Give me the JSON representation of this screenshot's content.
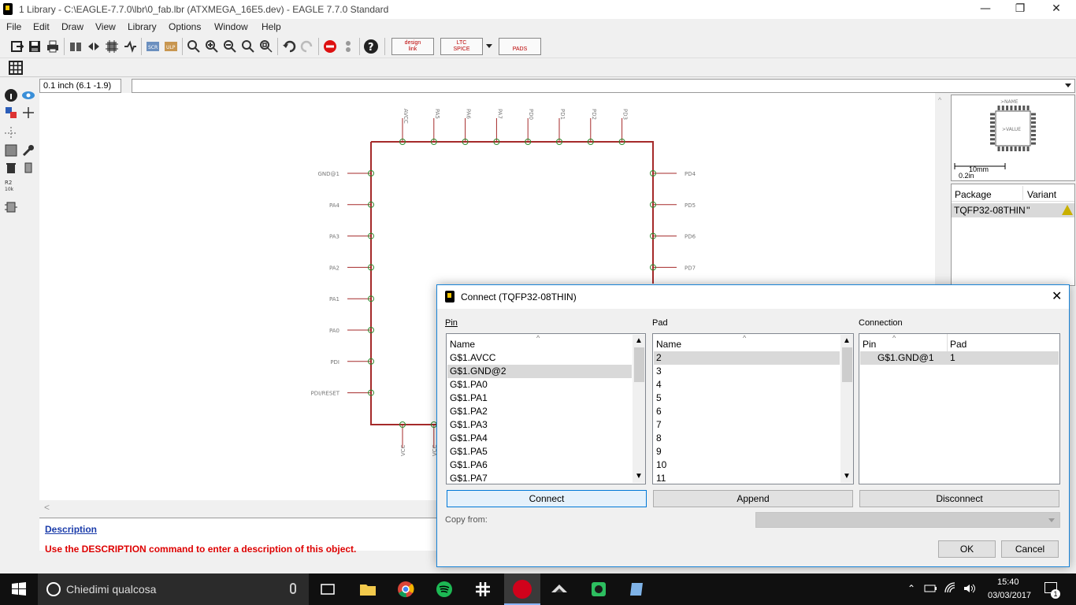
{
  "window": {
    "title": "1 Library - C:\\EAGLE-7.7.0\\lbr\\0_fab.lbr (ATXMEGA_16E5.dev) - EAGLE 7.7.0 Standard",
    "minimize": "—",
    "maximize": "❐",
    "close": "✕"
  },
  "menu": [
    "File",
    "Edit",
    "Draw",
    "View",
    "Library",
    "Options",
    "Window",
    "Help"
  ],
  "toolbar": {
    "icons": [
      "open-icon",
      "save-icon",
      "print-icon",
      "cam-icon",
      "fwd-back-icon",
      "board-icon",
      "schematic-icon",
      "script-icon",
      "run-icon",
      "zoom-fit-icon",
      "zoom-in-icon",
      "zoom-out-icon",
      "zoom-redraw-icon",
      "zoom-select-icon",
      "undo-icon",
      "redo-icon",
      "stop-icon",
      "go-icon",
      "help-icon"
    ],
    "brands": [
      {
        "line1": "design",
        "line2": "link"
      },
      {
        "line1": "LTC",
        "line2": "SPICE"
      },
      {
        "line1": "",
        "line2": "PADS"
      }
    ]
  },
  "coord": "0.1 inch (6.1 -1.9)",
  "schematic": {
    "top_pins": [
      "AVCC",
      "PA5",
      "PA6",
      "PA7",
      "PD0",
      "PD1",
      "PD2",
      "PD3"
    ],
    "left_pins": [
      "GND@1",
      "PA4",
      "PA3",
      "PA2",
      "PA1",
      "PA0",
      "PDI",
      "PDI/RESET"
    ],
    "right_pins": [
      "PD4",
      "PD5",
      "PD6",
      "PD7"
    ],
    "bottom_pins": [
      "VCC",
      "VCC"
    ]
  },
  "description": {
    "heading": "Description",
    "text": "Use the DESCRIPTION command to enter a description of this object."
  },
  "right_panel": {
    "scale_mm": "10mm",
    "scale_in": "0.2in",
    "package_header": "Package",
    "variant_header": "Variant",
    "package_name": "TQFP32-08THIN",
    "variant_name": "''",
    "preview_label": ">NAME",
    "preview_value": ">VALUE"
  },
  "dialog": {
    "title": "Connect  (TQFP32-08THIN)",
    "pin_label": "Pin",
    "pad_label": "Pad",
    "connection_label": "Connection",
    "name_header": "Name",
    "pins": [
      "G$1.AVCC",
      "G$1.GND@2",
      "G$1.PA0",
      "G$1.PA1",
      "G$1.PA2",
      "G$1.PA3",
      "G$1.PA4",
      "G$1.PA5",
      "G$1.PA6",
      "G$1.PA7"
    ],
    "pins_selected": 1,
    "pads": [
      "2",
      "3",
      "4",
      "5",
      "6",
      "7",
      "8",
      "9",
      "10",
      "11"
    ],
    "pads_selected": 0,
    "conn_pin_header": "Pin",
    "conn_pad_header": "Pad",
    "connection": {
      "pin": "G$1.GND@1",
      "pad": "1"
    },
    "connect_btn": "Connect",
    "append_btn": "Append",
    "disconnect_btn": "Disconnect",
    "copy_from_label": "Copy from:",
    "ok_btn": "OK",
    "cancel_btn": "Cancel"
  },
  "taskbar": {
    "search_placeholder": "Chiedimi qualcosa",
    "time": "15:40",
    "date": "03/03/2017",
    "notification_count": "1"
  },
  "colors": {
    "wire": "#a52a2a",
    "pin_line": "#a52a2a",
    "pin_circle": "#2e8b2e",
    "description_heading": "#1b3caa",
    "description_text": "#dd0000",
    "dialog_border": "#1883d7"
  }
}
